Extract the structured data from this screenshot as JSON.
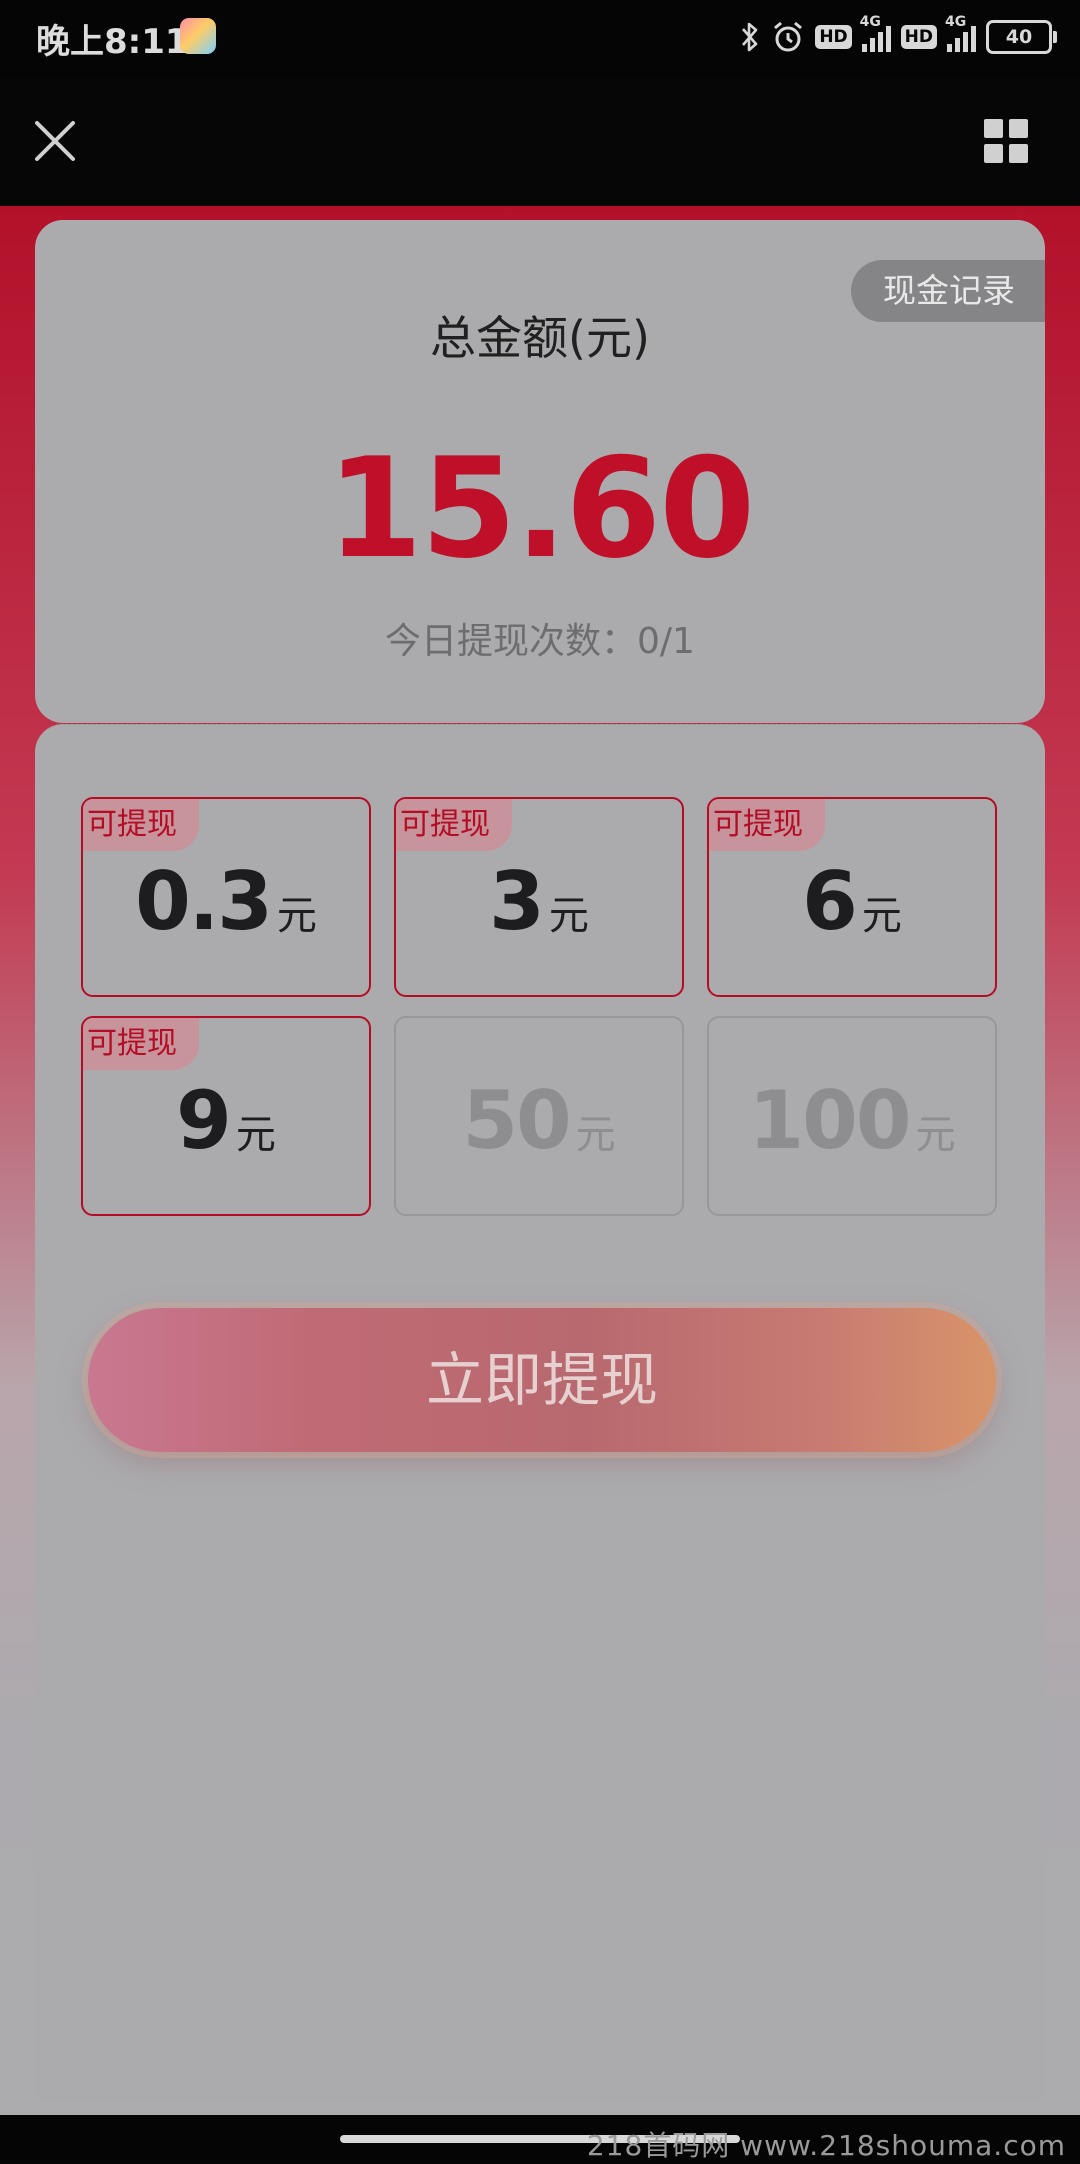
{
  "status_bar": {
    "time": "晚上8:11",
    "battery": "40",
    "hd_label": "HD",
    "network": "4G"
  },
  "nav": {
    "close_icon": "close-icon",
    "menu_icon": "grid-menu-icon"
  },
  "summary": {
    "cash_record_label": "现金记录",
    "total_label": "总金额(元)",
    "total_amount": "15.60",
    "withdraw_count": "今日提现次数：0/1"
  },
  "options": [
    {
      "tag": "可提现",
      "value": "0.3",
      "unit": "元",
      "available": true
    },
    {
      "tag": "可提现",
      "value": "3",
      "unit": "元",
      "available": true
    },
    {
      "tag": "可提现",
      "value": "6",
      "unit": "元",
      "available": true
    },
    {
      "tag": "可提现",
      "value": "9",
      "unit": "元",
      "available": true
    },
    {
      "tag": "",
      "value": "50",
      "unit": "元",
      "available": false
    },
    {
      "tag": "",
      "value": "100",
      "unit": "元",
      "available": false
    }
  ],
  "withdraw_button": "立即提现",
  "watermark": "218首码网 www.218shouma.com",
  "colors": {
    "accent_red": "#c00f28",
    "card_bg": "#ababae"
  }
}
